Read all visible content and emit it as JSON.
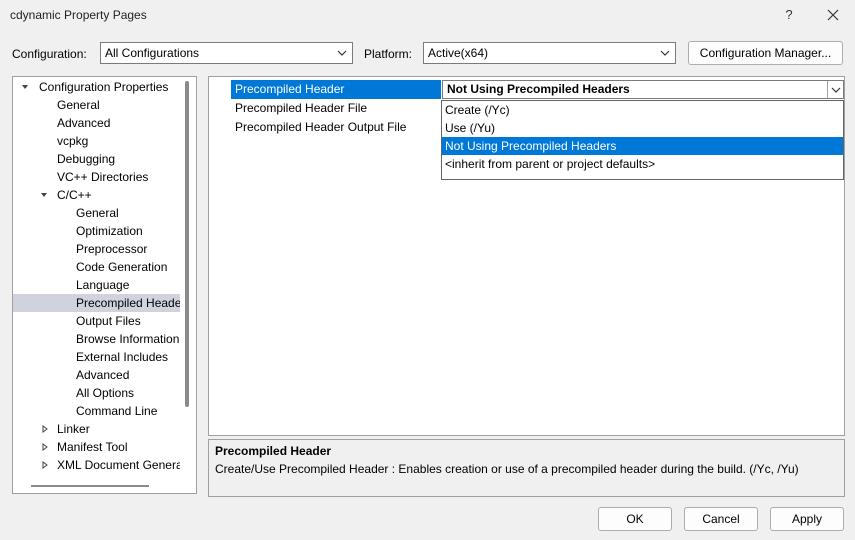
{
  "window": {
    "title": "cdynamic Property Pages",
    "help_glyph": "?"
  },
  "config": {
    "configuration_label": "Configuration:",
    "configuration_value": "All Configurations",
    "platform_label": "Platform:",
    "platform_value": "Active(x64)",
    "manager_button": "Configuration Manager..."
  },
  "tree": {
    "items": [
      {
        "label": "Configuration Properties",
        "level": 0,
        "expander": "expanded"
      },
      {
        "label": "General",
        "level": 1
      },
      {
        "label": "Advanced",
        "level": 1
      },
      {
        "label": "vcpkg",
        "level": 1
      },
      {
        "label": "Debugging",
        "level": 1
      },
      {
        "label": "VC++ Directories",
        "level": 1
      },
      {
        "label": "C/C++",
        "level": 1,
        "expander": "expanded"
      },
      {
        "label": "General",
        "level": 2
      },
      {
        "label": "Optimization",
        "level": 2
      },
      {
        "label": "Preprocessor",
        "level": 2
      },
      {
        "label": "Code Generation",
        "level": 2
      },
      {
        "label": "Language",
        "level": 2
      },
      {
        "label": "Precompiled Headers",
        "level": 2,
        "selected": true
      },
      {
        "label": "Output Files",
        "level": 2
      },
      {
        "label": "Browse Information",
        "level": 2
      },
      {
        "label": "External Includes",
        "level": 2
      },
      {
        "label": "Advanced",
        "level": 2
      },
      {
        "label": "All Options",
        "level": 2
      },
      {
        "label": "Command Line",
        "level": 2
      },
      {
        "label": "Linker",
        "level": 1,
        "expander": "collapsed"
      },
      {
        "label": "Manifest Tool",
        "level": 1,
        "expander": "collapsed"
      },
      {
        "label": "XML Document Generator",
        "level": 1,
        "expander": "collapsed"
      }
    ]
  },
  "grid": {
    "properties": [
      {
        "name": "Precompiled Header",
        "selected": true
      },
      {
        "name": "Precompiled Header File"
      },
      {
        "name": "Precompiled Header Output File"
      }
    ],
    "current_value": "Not Using Precompiled Headers"
  },
  "dropdown": {
    "options": [
      {
        "label": "Create (/Yc)"
      },
      {
        "label": "Use (/Yu)"
      },
      {
        "label": "Not Using Precompiled Headers",
        "highlighted": true
      },
      {
        "label": "<inherit from parent or project defaults>"
      }
    ]
  },
  "description": {
    "title": "Precompiled Header",
    "text": "Create/Use Precompiled Header : Enables creation or use of a precompiled header during the build.      (/Yc, /Yu)"
  },
  "buttons": {
    "ok": "OK",
    "cancel": "Cancel",
    "apply": "Apply"
  },
  "colors": {
    "selection": "#0078d7",
    "tree_selection": "#d0d3de",
    "background": "#f0f0f0"
  },
  "icons": {
    "close": "close-icon",
    "combo_arrow": "chevron-down-icon",
    "tree_expanded": "triangle-down-icon",
    "tree_collapsed": "triangle-right-icon"
  }
}
